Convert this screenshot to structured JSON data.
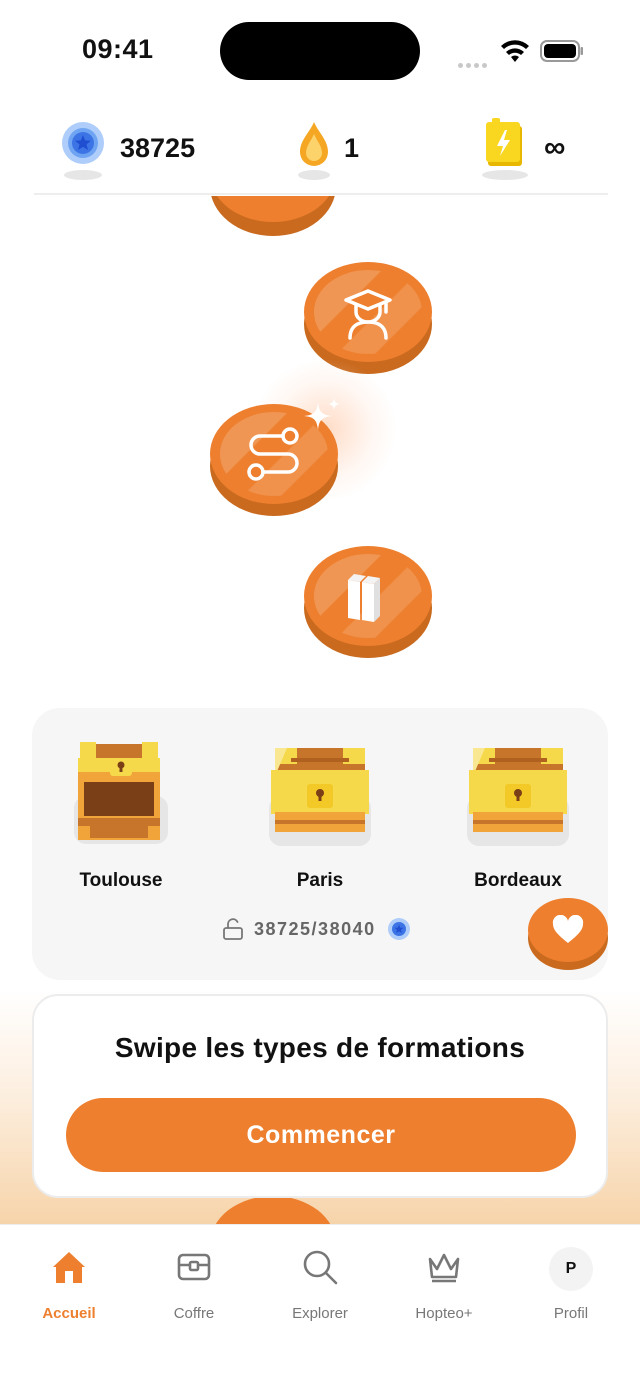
{
  "status_bar": {
    "time": "09:41"
  },
  "stats": {
    "points": "38725",
    "streak": "1",
    "energy": "∞"
  },
  "path": {
    "nodes": [
      {
        "icon": "graduation-cap-user-icon"
      },
      {
        "icon": "path-route-icon",
        "highlighted": true
      },
      {
        "icon": "books-icon"
      }
    ]
  },
  "chests": {
    "items": [
      {
        "label": "Toulouse",
        "state": "open"
      },
      {
        "label": "Paris",
        "state": "locked"
      },
      {
        "label": "Bordeaux",
        "state": "locked"
      }
    ],
    "progress": "38725/38040"
  },
  "action_card": {
    "title": "Swipe les types de formations",
    "button": "Commencer"
  },
  "tabs": [
    {
      "label": "Accueil",
      "icon": "home-icon",
      "active": true
    },
    {
      "label": "Coffre",
      "icon": "chest-icon"
    },
    {
      "label": "Explorer",
      "icon": "search-icon"
    },
    {
      "label": "Hopteo+",
      "icon": "crown-icon"
    },
    {
      "label": "Profil",
      "icon": "avatar",
      "initial": "P"
    }
  ],
  "colors": {
    "accent": "#ed7f2e",
    "accent_dark": "#c96a1e",
    "gold": "#f6d94a"
  }
}
